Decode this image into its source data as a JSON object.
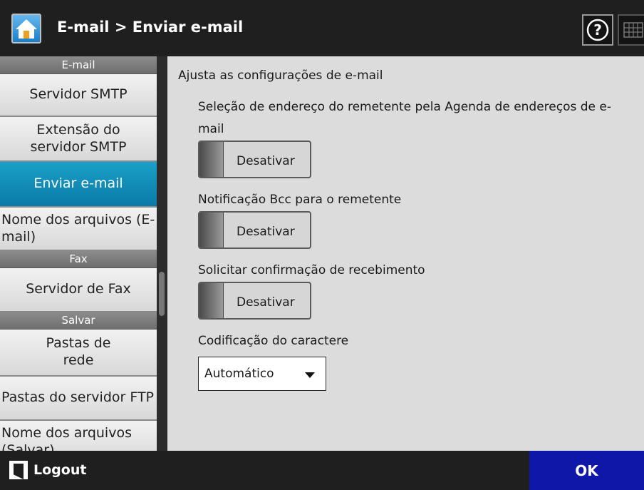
{
  "header": {
    "title": "E-mail > Enviar e-mail",
    "icons": [
      "home-icon",
      "help-icon",
      "keyboard-icon"
    ]
  },
  "sidebar": {
    "sections": [
      {
        "title": "E-mail",
        "items": [
          "Servidor SMTP",
          "Extensão do servidor SMTP",
          "Enviar e-mail",
          "Nome dos arquivos (E-mail)"
        ]
      },
      {
        "title": "Fax",
        "items": [
          "Servidor de Fax"
        ]
      },
      {
        "title": "Salvar",
        "items": [
          "Pastas de rede",
          "Pastas do servidor FTP",
          "Nome dos arquivos (Salvar)"
        ]
      }
    ],
    "selected": "Enviar e-mail"
  },
  "main": {
    "description": "Ajusta as configurações de e-mail",
    "settings": [
      {
        "label": "Seleção de endereço do remetente pela Agenda de endereços de e-mail",
        "state": "Desativar"
      },
      {
        "label": "Notificação Bcc para o remetente",
        "state": "Desativar"
      },
      {
        "label": "Solicitar confirmação de recebimento",
        "state": "Desativar"
      }
    ],
    "encoding": {
      "label": "Codificação do caractere",
      "value": "Automático"
    }
  },
  "footer": {
    "logout_label": "Logout",
    "ok_label": "OK"
  },
  "colors": {
    "selected_item": "#0a8cbc",
    "ok_button": "#0f17a8",
    "background": "#dcdcdc"
  }
}
